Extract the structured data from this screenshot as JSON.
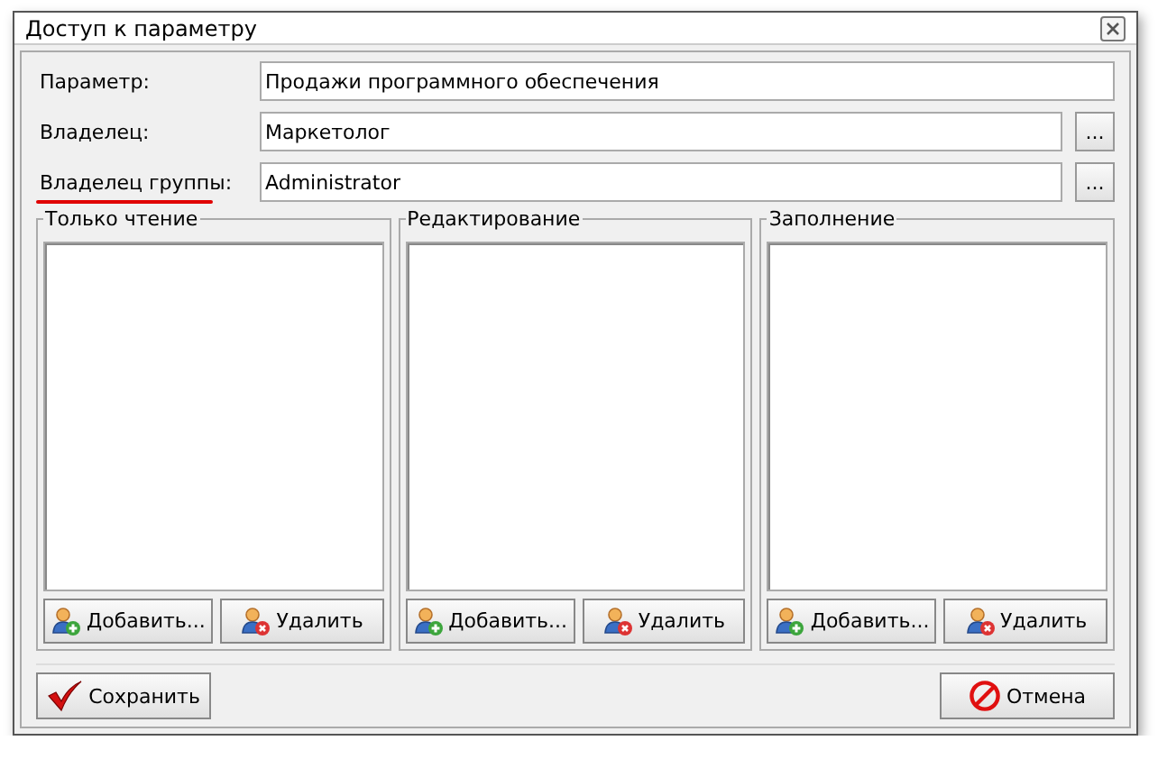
{
  "window": {
    "title": "Доступ к параметру"
  },
  "fields": [
    {
      "label": "Параметр:",
      "value": "Продажи программного обеспечения",
      "has_browse": false,
      "underlined": false
    },
    {
      "label": "Владелец:",
      "value": "Маркетолог",
      "has_browse": true,
      "browse_label": "...",
      "underlined": false
    },
    {
      "label": "Владелец группы:",
      "value": "Administrator",
      "has_browse": true,
      "browse_label": "...",
      "underlined": true
    }
  ],
  "groups": [
    {
      "title": "Только чтение",
      "buttons": [
        {
          "label": "Добавить...",
          "kind": "add"
        },
        {
          "label": "Удалить",
          "kind": "remove"
        }
      ]
    },
    {
      "title": "Редактирование",
      "buttons": [
        {
          "label": "Добавить...",
          "kind": "add"
        },
        {
          "label": "Удалить",
          "kind": "remove"
        }
      ]
    },
    {
      "title": "Заполнение",
      "buttons": [
        {
          "label": "Добавить...",
          "kind": "add"
        },
        {
          "label": "Удалить",
          "kind": "remove"
        }
      ]
    }
  ],
  "footer_buttons": [
    {
      "label": "Сохранить",
      "kind": "save"
    },
    {
      "label": "Отмена",
      "kind": "cancel"
    }
  ]
}
